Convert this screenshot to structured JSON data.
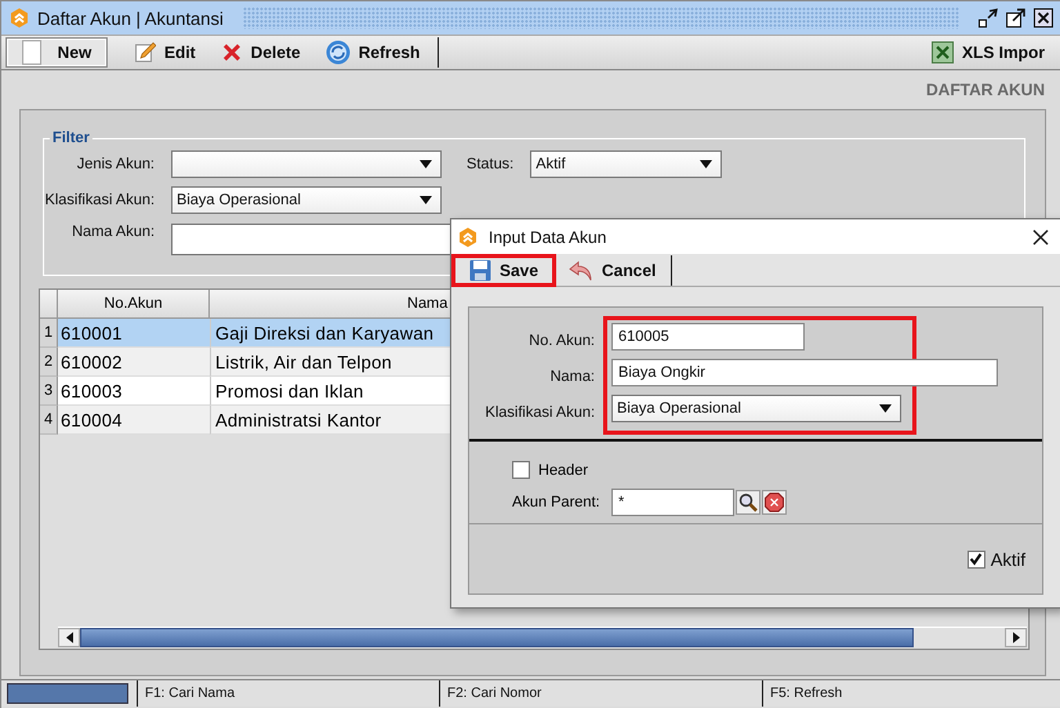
{
  "window": {
    "title": "Daftar Akun | Akuntansi"
  },
  "toolbar": {
    "left": [
      {
        "label": "New",
        "framed": true
      },
      {
        "label": "Edit",
        "framed": false
      },
      {
        "label": "Delete",
        "framed": false
      },
      {
        "label": "Refresh",
        "framed": false
      }
    ],
    "right": [
      {
        "label": "XLS Impor",
        "framed": false
      }
    ]
  },
  "heading": "DAFTAR AKUN",
  "filter": {
    "title": "Filter",
    "jenis_akun": {
      "label": "Jenis Akun:"
    },
    "status": {
      "label": "Status:",
      "value": "Aktif"
    },
    "klasifikasi_akun": {
      "label": "Klasifikasi Akun:",
      "value": "Biaya Operasional"
    },
    "nama_akun": {
      "label": "Nama Akun:"
    }
  },
  "table": {
    "columns": [
      "No.Akun",
      "Nama"
    ],
    "rows": [
      {
        "number": "1",
        "cells": [
          "610001",
          "Gaji Direksi dan Karyawan"
        ],
        "selected": true
      },
      {
        "number": "2",
        "cells": [
          "610002",
          "Listrik, Air dan Telpon"
        ],
        "selected": false
      },
      {
        "number": "3",
        "cells": [
          "610003",
          "Promosi dan Iklan"
        ],
        "selected": false
      },
      {
        "number": "4",
        "cells": [
          "610004",
          "Administratsi Kantor"
        ],
        "selected": false
      }
    ]
  },
  "status_bar": [
    "F1: Cari Nama",
    "F2: Cari Nomor",
    "F5: Refresh"
  ],
  "dialog": {
    "title": "Input Data Akun",
    "toolbar": [
      {
        "label": "Save",
        "highlighted": true
      },
      {
        "label": "Cancel",
        "highlighted": false
      }
    ],
    "fields_highlighted": true,
    "fields": [
      {
        "label": "No. Akun:",
        "kind": "text",
        "value": "610005"
      },
      {
        "label": "Nama:",
        "kind": "text",
        "value": "Biaya Ongkir"
      },
      {
        "label": "Klasifikasi Akun:",
        "kind": "combo",
        "value": "Biaya Operasional"
      }
    ],
    "header": {
      "label": "Header",
      "checked": false
    },
    "akun_parent": {
      "label": "Akun Parent:",
      "value": "*"
    },
    "aktif": {
      "label": "Aktif",
      "checked": true
    }
  }
}
